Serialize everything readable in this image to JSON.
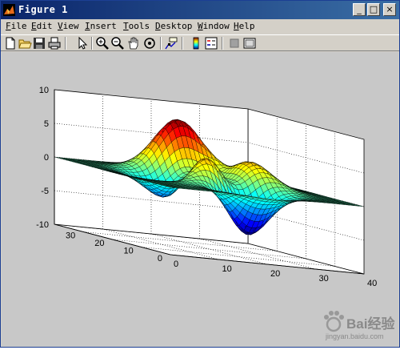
{
  "window": {
    "title": "Figure 1"
  },
  "title_buttons": {
    "minimize": "_",
    "maximize": "□",
    "close": "×"
  },
  "menu": [
    "File",
    "Edit",
    "View",
    "Insert",
    "Tools",
    "Desktop",
    "Window",
    "Help"
  ],
  "toolbar": [
    "new-figure-icon",
    "open-file-icon",
    "save-icon",
    "print-icon",
    "pointer-icon",
    "zoom-in-icon",
    "zoom-out-icon",
    "pan-icon",
    "rotate-3d-icon",
    "data-cursor-icon",
    "colorbar-icon",
    "legend-icon",
    "hide-plot-tools-icon",
    "show-plot-tools-icon"
  ],
  "chart_data": {
    "type": "surface",
    "function": "peaks",
    "x_ticks": [
      "0",
      "10",
      "20",
      "30",
      "40"
    ],
    "y_ticks": [
      "0",
      "10",
      "20",
      "30"
    ],
    "z_ticks": [
      "-10",
      "-5",
      "0",
      "5",
      "10"
    ],
    "zlim": [
      -10,
      10
    ],
    "grid": true,
    "colormap": "jet"
  },
  "watermark": {
    "text": "Bai经验",
    "url": "jingyan.baidu.com"
  }
}
